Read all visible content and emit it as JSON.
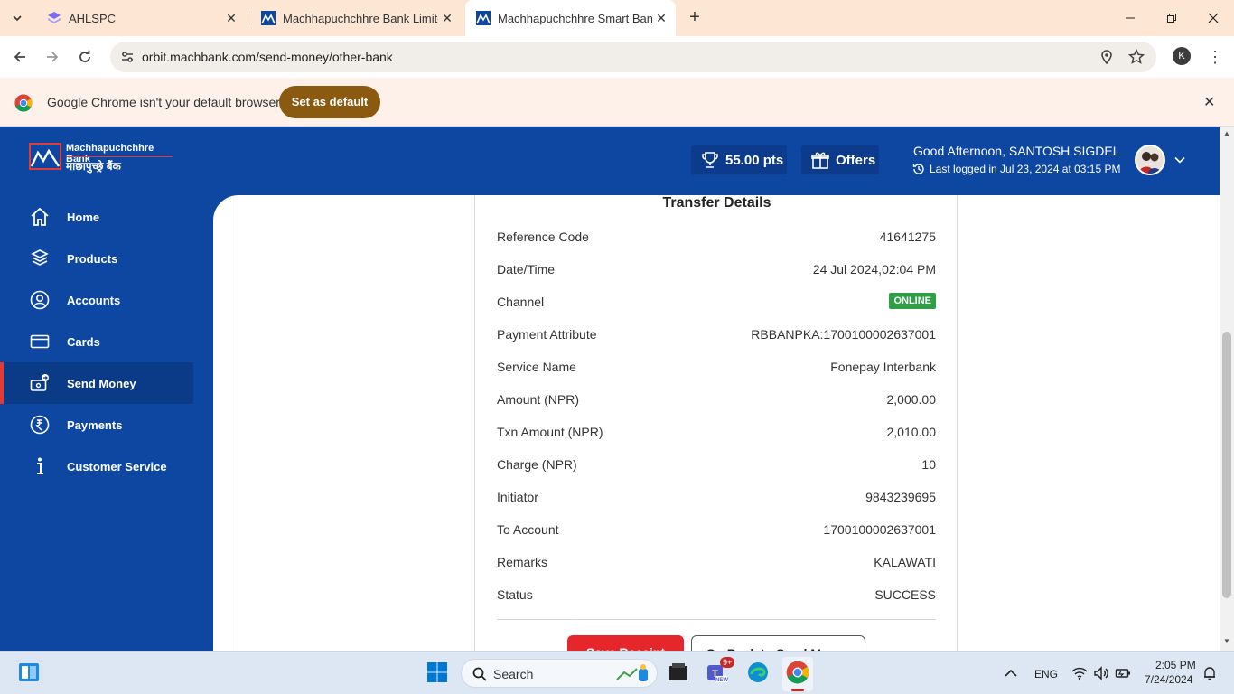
{
  "browser": {
    "tabs": [
      {
        "title": "AHLSPC",
        "active": false
      },
      {
        "title": "Machhapuchchhre Bank Limited",
        "active": false
      },
      {
        "title": "Machhapuchchhre Smart Banking",
        "active": true
      }
    ],
    "url": "orbit.machbank.com/send-money/other-bank",
    "profile_initial": "K",
    "infobar": {
      "message": "Google Chrome isn't your default browser",
      "button": "Set as default"
    }
  },
  "header": {
    "logo_en": "Machhapuchchhre Bank",
    "logo_np": "माछापुच्छ्रे बैंक",
    "points": "55.00 pts",
    "offers": "Offers",
    "greeting": "Good Afternoon, SANTOSH SIGDEL",
    "last_login": "Last logged in Jul 23, 2024 at 03:15 PM"
  },
  "sidebar": {
    "items": [
      {
        "label": "Home",
        "icon": "home-icon"
      },
      {
        "label": "Products",
        "icon": "products-icon"
      },
      {
        "label": "Accounts",
        "icon": "accounts-icon"
      },
      {
        "label": "Cards",
        "icon": "card-icon"
      },
      {
        "label": "Send Money",
        "icon": "send-money-icon",
        "active": true
      },
      {
        "label": "Payments",
        "icon": "payments-icon"
      },
      {
        "label": "Customer Service",
        "icon": "info-icon"
      }
    ]
  },
  "transfer": {
    "title": "Transfer Details",
    "rows": [
      {
        "label": "Reference Code",
        "value": "41641275"
      },
      {
        "label": "Date/Time",
        "value": "24 Jul 2024,02:04 PM"
      },
      {
        "label": "Channel",
        "value": "ONLINE"
      },
      {
        "label": "Payment Attribute",
        "value": "RBBANPKA:1700100002637001"
      },
      {
        "label": "Service Name",
        "value": "Fonepay Interbank"
      },
      {
        "label": "Amount (NPR)",
        "value": "2,000.00"
      },
      {
        "label": "Txn Amount (NPR)",
        "value": "2,010.00"
      },
      {
        "label": "Charge (NPR)",
        "value": "10"
      },
      {
        "label": "Initiator",
        "value": "9843239695"
      },
      {
        "label": "To Account",
        "value": "1700100002637001"
      },
      {
        "label": "Remarks",
        "value": "KALAWATI"
      },
      {
        "label": "Status",
        "value": "SUCCESS"
      }
    ],
    "primary_button": "Save Receipt",
    "secondary_button": "Go Back to Send Money"
  },
  "taskbar": {
    "search_placeholder": "Search",
    "language": "ENG",
    "time": "2:05 PM",
    "date": "7/24/2024",
    "teams_badge": "9+"
  },
  "colors": {
    "brand_blue": "#0d47a1",
    "brand_red": "#e5262b",
    "success_green": "#2e9e47"
  }
}
